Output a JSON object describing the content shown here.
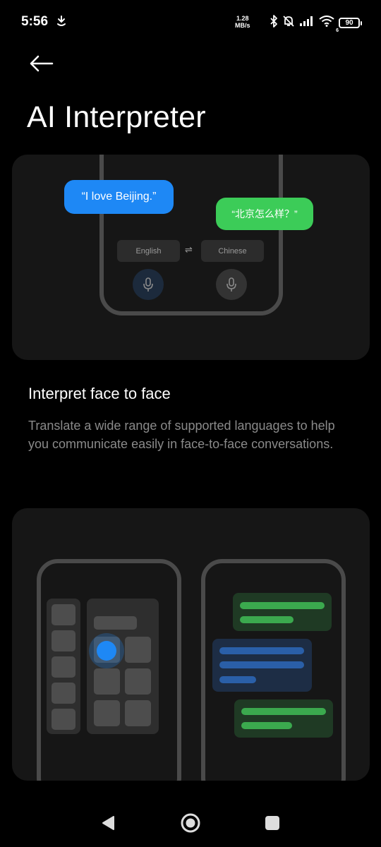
{
  "status_bar": {
    "time": "5:56",
    "net_speed_value": "1.28",
    "net_speed_unit": "MB/s",
    "wifi_label": "6",
    "battery": "90",
    "icons": [
      "download-icon",
      "bluetooth-icon",
      "bell-off-icon",
      "signal-icon",
      "wifi-icon",
      "battery-icon"
    ]
  },
  "header": {
    "back_icon": "arrow-left-icon",
    "title": "AI Interpreter"
  },
  "feature_card": {
    "bubble_english": "“I love Beijing.”",
    "bubble_chinese": "“北京怎么样？”",
    "lang_left": "English",
    "lang_right": "Chinese",
    "swap_icon": "⇌",
    "colors": {
      "english_bubble": "#1e88f5",
      "chinese_bubble": "#3ccc58"
    }
  },
  "section": {
    "heading": "Interpret face to face",
    "description": "Translate a wide range of supported languages to help you communicate easily in face-to-face conversations."
  },
  "nav_bar": {
    "icons": [
      "back-triangle-icon",
      "home-circle-icon",
      "recents-square-icon"
    ]
  }
}
